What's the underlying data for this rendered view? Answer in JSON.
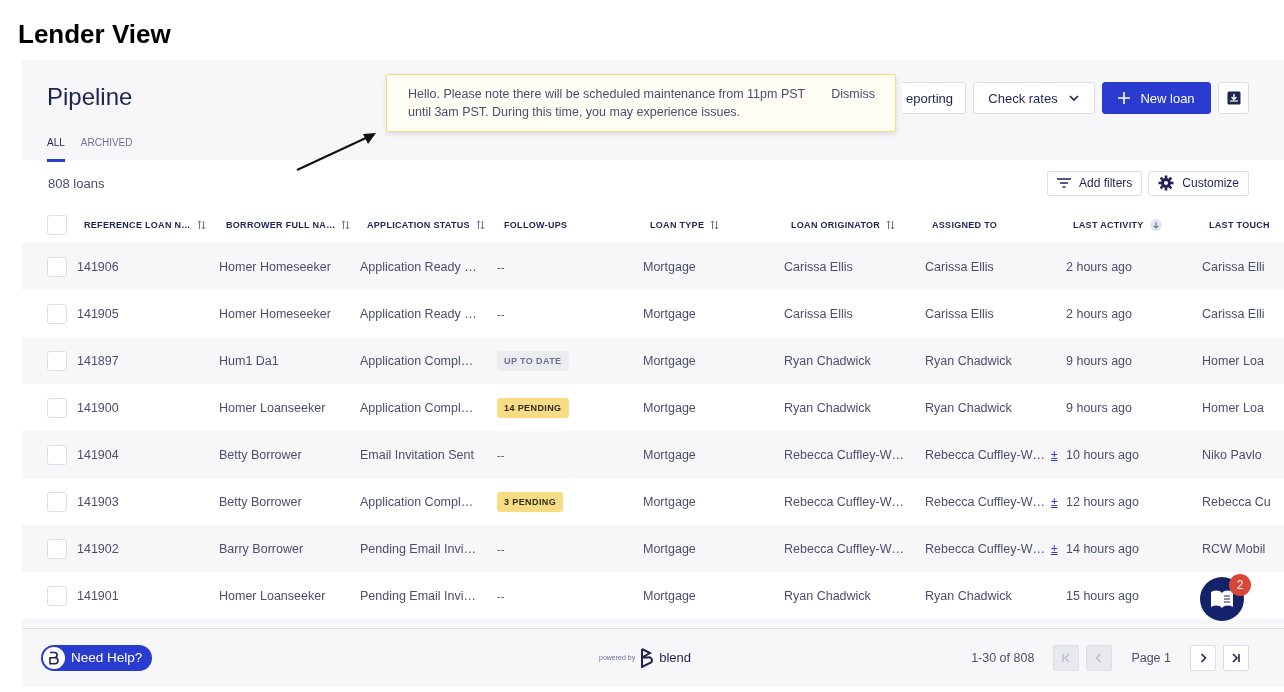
{
  "page_title": "Lender View",
  "header": {
    "title": "Pipeline",
    "tabs": [
      {
        "label": "ALL",
        "selected": true
      },
      {
        "label": "ARCHIVED",
        "selected": false
      }
    ],
    "buttons": [
      {
        "label": "eporting",
        "kind": "plain"
      },
      {
        "label": "Check rates",
        "kind": "dropdown"
      },
      {
        "label": "New loan",
        "kind": "primary"
      },
      {
        "kind": "download"
      }
    ]
  },
  "banner": {
    "message": "Hello. Please note there will be scheduled maintenance from 11pm PST until 3am PST. During this time, you may experience issues.",
    "action": "Dismiss"
  },
  "toolbar": {
    "count": "808 loans",
    "buttons": [
      {
        "label": "Add filters",
        "kind": "filter"
      },
      {
        "label": "Customize",
        "kind": "gear"
      }
    ]
  },
  "table": {
    "select_all": {
      "checked": false
    },
    "columns": [
      {
        "label": "REFERENCE LOAN N…",
        "sortable": true,
        "sorted_descending": false
      },
      {
        "label": "BORROWER FULL NA…",
        "sortable": true,
        "sorted_descending": false
      },
      {
        "label": "APPLICATION STATUS",
        "sortable": true,
        "sorted_descending": false
      },
      {
        "label": "FOLLOW-UPS",
        "sortable": false,
        "sorted_descending": false
      },
      {
        "label": "LOAN TYPE",
        "sortable": true,
        "sorted_descending": false
      },
      {
        "label": "LOAN ORIGINATOR",
        "sortable": true,
        "sorted_descending": false
      },
      {
        "label": "ASSIGNED TO",
        "sortable": false,
        "sorted_descending": false
      },
      {
        "label": "LAST ACTIVITY",
        "sortable": true,
        "sorted_descending": true
      },
      {
        "label": "LAST TOUCH",
        "sortable": false,
        "sorted_descending": false
      }
    ],
    "rows": [
      {
        "checked": false,
        "ref": "141906",
        "borrower": "Homer Homeseeker",
        "status": "Application Ready …",
        "follow_up": {
          "text": "--",
          "kind": "none"
        },
        "loan_type": "Mortgage",
        "originator": "Carissa Ellis",
        "assigned": {
          "text": "Carissa Ellis"
        },
        "activity": "2 hours ago",
        "last_touch": "Carissa Elli"
      },
      {
        "checked": false,
        "ref": "141905",
        "borrower": "Homer Homeseeker",
        "status": "Application Ready …",
        "follow_up": {
          "text": "--",
          "kind": "none"
        },
        "loan_type": "Mortgage",
        "originator": "Carissa Ellis",
        "assigned": {
          "text": "Carissa Ellis"
        },
        "activity": "2 hours ago",
        "last_touch": "Carissa Elli"
      },
      {
        "checked": false,
        "ref": "141897",
        "borrower": "Hum1 Da1",
        "status": "Application Compl…",
        "follow_up": {
          "text": "UP TO DATE",
          "kind": "neutral"
        },
        "loan_type": "Mortgage",
        "originator": "Ryan Chadwick",
        "assigned": {
          "text": "Ryan Chadwick"
        },
        "activity": "9 hours ago",
        "last_touch": "Homer Loa"
      },
      {
        "checked": false,
        "ref": "141900",
        "borrower": "Homer Loanseeker",
        "status": "Application Compl…",
        "follow_up": {
          "text": "14 PENDING",
          "kind": "pending"
        },
        "loan_type": "Mortgage",
        "originator": "Ryan Chadwick",
        "assigned": {
          "text": "Ryan Chadwick"
        },
        "activity": "9 hours ago",
        "last_touch": "Homer Loa"
      },
      {
        "checked": false,
        "ref": "141904",
        "borrower": "Betty Borrower",
        "status": "Email Invitation Sent",
        "follow_up": {
          "text": "--",
          "kind": "none"
        },
        "loan_type": "Mortgage",
        "originator": "Rebecca Cuffley-W…",
        "assigned": {
          "text": "Rebecca Cuffley-W…",
          "extra": "±"
        },
        "activity": "10 hours ago",
        "last_touch": "Niko Pavlo"
      },
      {
        "checked": false,
        "ref": "141903",
        "borrower": "Betty Borrower",
        "status": "Application Compl…",
        "follow_up": {
          "text": "3 PENDING",
          "kind": "pending"
        },
        "loan_type": "Mortgage",
        "originator": "Rebecca Cuffley-W…",
        "assigned": {
          "text": "Rebecca Cuffley-W…",
          "extra": "±"
        },
        "activity": "12 hours ago",
        "last_touch": "Rebecca Cu"
      },
      {
        "checked": false,
        "ref": "141902",
        "borrower": "Barry Borrower",
        "status": "Pending Email Invi…",
        "follow_up": {
          "text": "--",
          "kind": "none"
        },
        "loan_type": "Mortgage",
        "originator": "Rebecca Cuffley-W…",
        "assigned": {
          "text": "Rebecca Cuffley-W…",
          "extra": "±"
        },
        "activity": "14 hours ago",
        "last_touch": "RCW Mobil"
      },
      {
        "checked": false,
        "ref": "141901",
        "borrower": "Homer Loanseeker",
        "status": "Pending Email Invi…",
        "follow_up": {
          "text": "--",
          "kind": "none"
        },
        "loan_type": "Mortgage",
        "originator": "Ryan Chadwick",
        "assigned": {
          "text": "Ryan Chadwick"
        },
        "activity": "15 hours ago"
      }
    ]
  },
  "footer": {
    "help": "Need Help?",
    "powered_by": "powered by",
    "brand": "blend",
    "range": "1-30 of 808",
    "page": "Page 1",
    "pager": [
      {
        "kind": "first",
        "disabled": true
      },
      {
        "kind": "prev",
        "disabled": true
      },
      {
        "kind": "next",
        "disabled": false
      },
      {
        "kind": "last",
        "disabled": false
      }
    ]
  },
  "chat": {
    "badge": "2"
  }
}
